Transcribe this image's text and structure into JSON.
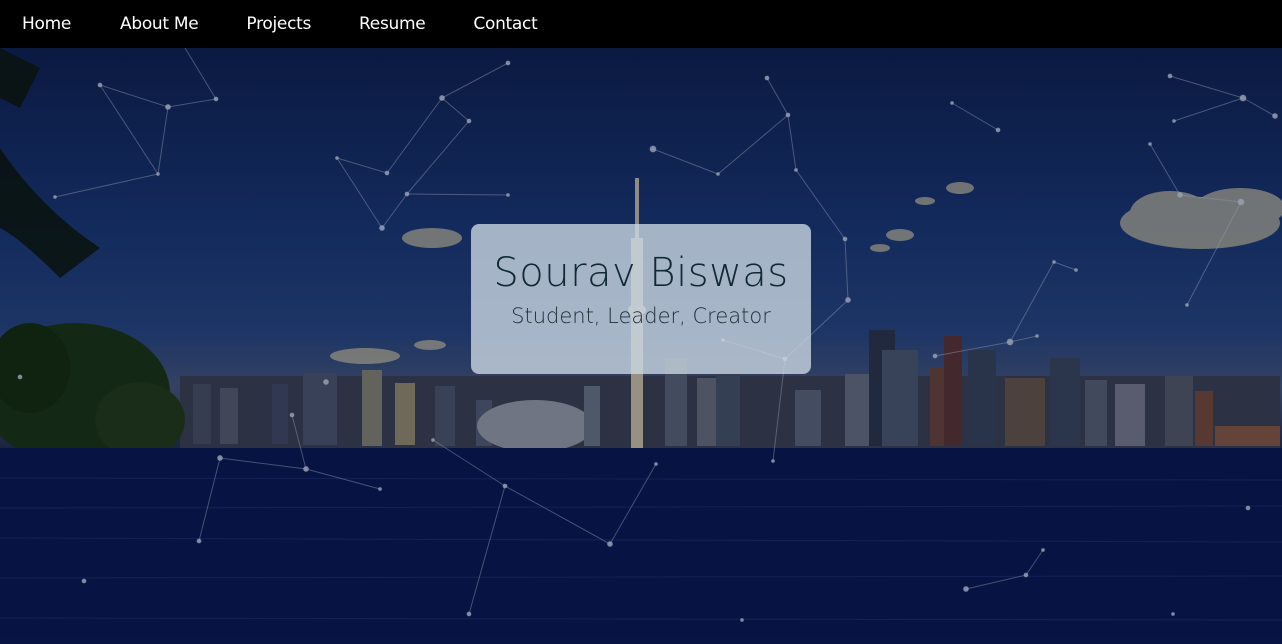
{
  "nav": {
    "items": [
      {
        "label": "Home"
      },
      {
        "label": "About Me"
      },
      {
        "label": "Projects"
      },
      {
        "label": "Resume"
      },
      {
        "label": "Contact"
      }
    ]
  },
  "hero": {
    "name": "Sourav Biswas",
    "tagline": "Student, Leader, Creator"
  },
  "colors": {
    "nav_bg": "#000000",
    "nav_text": "#ffffff",
    "card_bg": "rgba(205,218,228,0.78)",
    "name_text": "#0f2a33"
  }
}
